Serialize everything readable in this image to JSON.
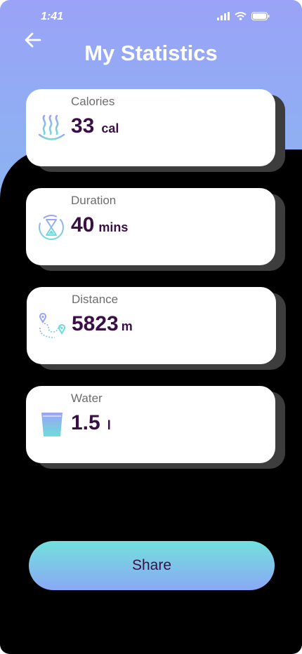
{
  "status": {
    "time": "1:41"
  },
  "header": {
    "title": "My Statistics"
  },
  "stats": [
    {
      "label": "Calories",
      "value": "33",
      "unit": "cal",
      "icon": "steam-heat-icon"
    },
    {
      "label": "Duration",
      "value": "40",
      "unit": "mins",
      "icon": "hourglass-icon"
    },
    {
      "label": "Distance",
      "value": "5823",
      "unit": "m",
      "icon": "route-pin-icon"
    },
    {
      "label": "Water",
      "value": "1.5",
      "unit": "l",
      "icon": "water-glass-icon"
    }
  ],
  "actions": {
    "share_label": "Share"
  },
  "colors": {
    "gradient_top": "#9aa3f7",
    "gradient_bottom": "#78dee0",
    "value_text": "#3a0f45",
    "card_shadow": "#3d3d3d"
  }
}
